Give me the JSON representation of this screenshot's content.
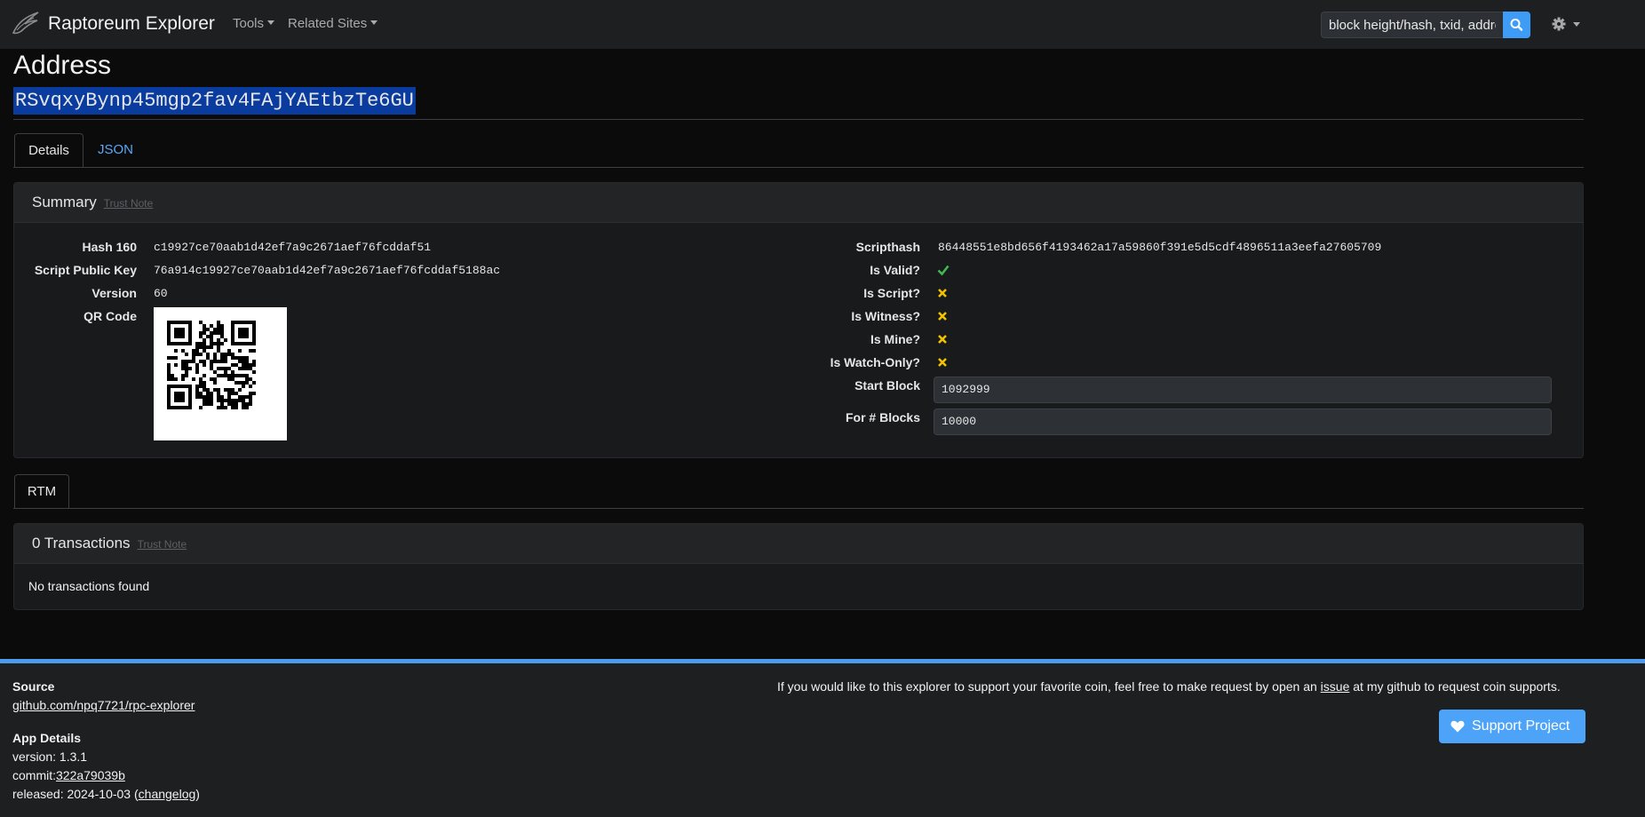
{
  "navbar": {
    "brand": "Raptoreum Explorer",
    "menu": [
      "Tools",
      "Related Sites"
    ],
    "search_placeholder": "block height/hash, txid, address",
    "icons": [
      "raptor-logo-icon",
      "search-icon",
      "gear-icon"
    ]
  },
  "header": {
    "title": "Address",
    "address": "RSvqxyBynp45mgp2fav4FAjYAEtbzTe6GU"
  },
  "tabs": {
    "details": "Details",
    "json": "JSON"
  },
  "summary": {
    "title": "Summary",
    "trust_note": "Trust Note",
    "left": [
      {
        "label": "Hash 160",
        "value": "c19927ce70aab1d42ef7a9c2671aef76fcddaf51"
      },
      {
        "label": "Script Public Key",
        "value": "76a914c19927ce70aab1d42ef7a9c2671aef76fcddaf5188ac"
      },
      {
        "label": "Version",
        "value": "60"
      },
      {
        "label": "QR Code",
        "value": ""
      }
    ],
    "scripthash_label": "Scripthash",
    "scripthash": "86448551e8bd656f4193462a17a59860f391e5d5cdf4896511a3eefa27605709",
    "checks": [
      {
        "label": "Is Valid?",
        "state": "yes"
      },
      {
        "label": "Is Script?",
        "state": "no"
      },
      {
        "label": "Is Witness?",
        "state": "no"
      },
      {
        "label": "Is Mine?",
        "state": "no"
      },
      {
        "label": "Is Watch-Only?",
        "state": "no"
      }
    ],
    "start_block_label": "Start Block",
    "start_block": "1092999",
    "blocks_label": "For # Blocks",
    "blocks": "10000"
  },
  "coin_tab": "RTM",
  "transactions": {
    "title": "0 Transactions",
    "trust_note": "Trust Note",
    "empty": "No transactions found"
  },
  "footer": {
    "source_title": "Source",
    "source_link": "github.com/npq7721/rpc-explorer",
    "app_title": "App Details",
    "version": "version: 1.3.1",
    "commit_prefix": "commit:",
    "commit": "322a79039b",
    "released_prefix": "released: 2024-10-03 (",
    "changelog": "changelog",
    "released_suffix": ")",
    "request_before": "If you would like to this explorer to support your favorite coin, feel free to make request by open an ",
    "issue": "issue",
    "request_after": " at my github to request coin supports.",
    "support_button": "Support Project"
  },
  "colors": {
    "accent": "#3e9cf6",
    "valid": "#3fb950",
    "invalid": "#f2c200",
    "footer_border": "#4c9bec"
  }
}
